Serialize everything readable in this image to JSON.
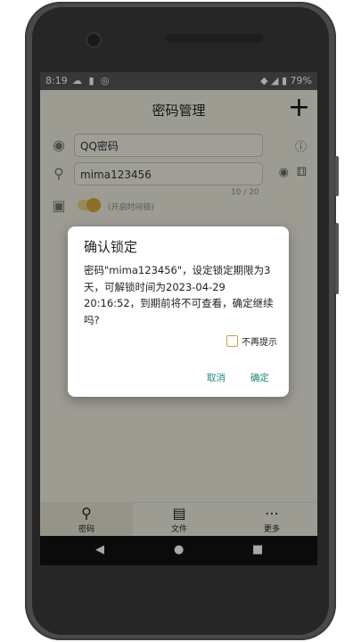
{
  "status": {
    "time": "8:19",
    "battery": "79%",
    "left_icons": "☁ ▮ ◎",
    "right_icons": "◆ ◢ ▮"
  },
  "appbar": {
    "title": "密码管理",
    "add_label": "+"
  },
  "form": {
    "name_value": "QQ密码",
    "password_value": "mima123456",
    "counter": "10 / 20",
    "lock_hint": "(开启时间锁)"
  },
  "dialog": {
    "title": "确认锁定",
    "message": "密码\"mima123456\"，设定锁定期限为3天，可解锁时间为2023-04-29 20:16:52，到期前将不可查看，确定继续吗?",
    "checkbox_label": "不再提示",
    "cancel_label": "取消",
    "ok_label": "确定"
  },
  "bottom_nav": [
    {
      "label": "密码",
      "icon": "key-icon"
    },
    {
      "label": "文件",
      "icon": "file-icon"
    },
    {
      "label": "更多",
      "icon": "more-icon"
    }
  ],
  "colors": {
    "accent": "#1a8a7a",
    "screen_bg": "#efeddf",
    "status_bar": "#555555"
  }
}
